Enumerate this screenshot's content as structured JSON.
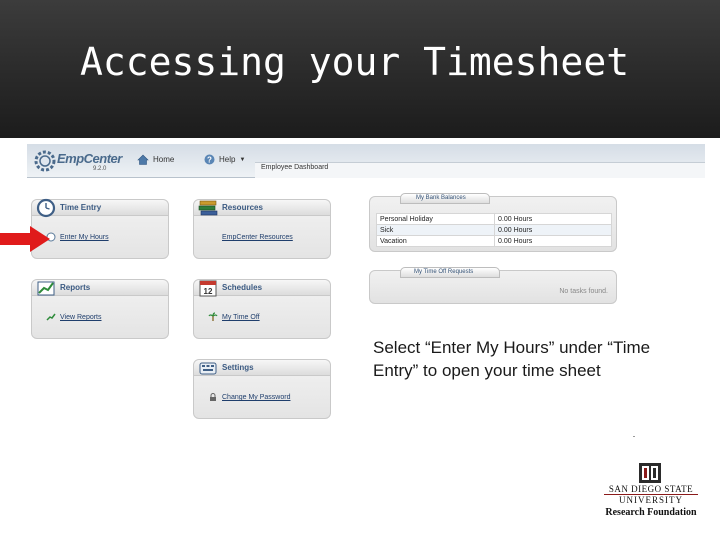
{
  "slide": {
    "title": "Accessing your Timesheet",
    "instruction": "Select “Enter My Hours” under “Time Entry” to open your time sheet"
  },
  "app": {
    "logo_text": "EmpCenter",
    "logo_version": "9.2.0",
    "nav_home": "Home",
    "nav_help": "Help",
    "dashboard_title": "Employee Dashboard"
  },
  "widgets": {
    "time_entry": {
      "title": "Time Entry",
      "link": "Enter My Hours",
      "icon": "clock-icon"
    },
    "resources": {
      "title": "Resources",
      "link": "EmpCenter Resources",
      "icon": "books-icon"
    },
    "reports": {
      "title": "Reports",
      "link": "View Reports",
      "icon": "chart-icon"
    },
    "schedules": {
      "title": "Schedules",
      "link": "My Time Off",
      "icon": "calendar-icon"
    },
    "settings": {
      "title": "Settings",
      "link": "Change My Password",
      "icon": "keyboard-icon"
    }
  },
  "balances": {
    "title": "My Bank Balances",
    "rows": [
      {
        "name": "Personal Holiday",
        "value": "0.00 Hours"
      },
      {
        "name": "Sick",
        "value": "0.00 Hours"
      },
      {
        "name": "Vacation",
        "value": "0.00 Hours"
      }
    ]
  },
  "time_off_requests": {
    "title": "My Time Off Requests",
    "empty_text": "No tasks found."
  },
  "branding": {
    "line1": "SAN DIEGO STATE",
    "line2": "UNIVERSITY",
    "line3": "Research Foundation"
  },
  "colors": {
    "accent_red": "#e01b1b",
    "link_blue": "#1f3e6c"
  }
}
